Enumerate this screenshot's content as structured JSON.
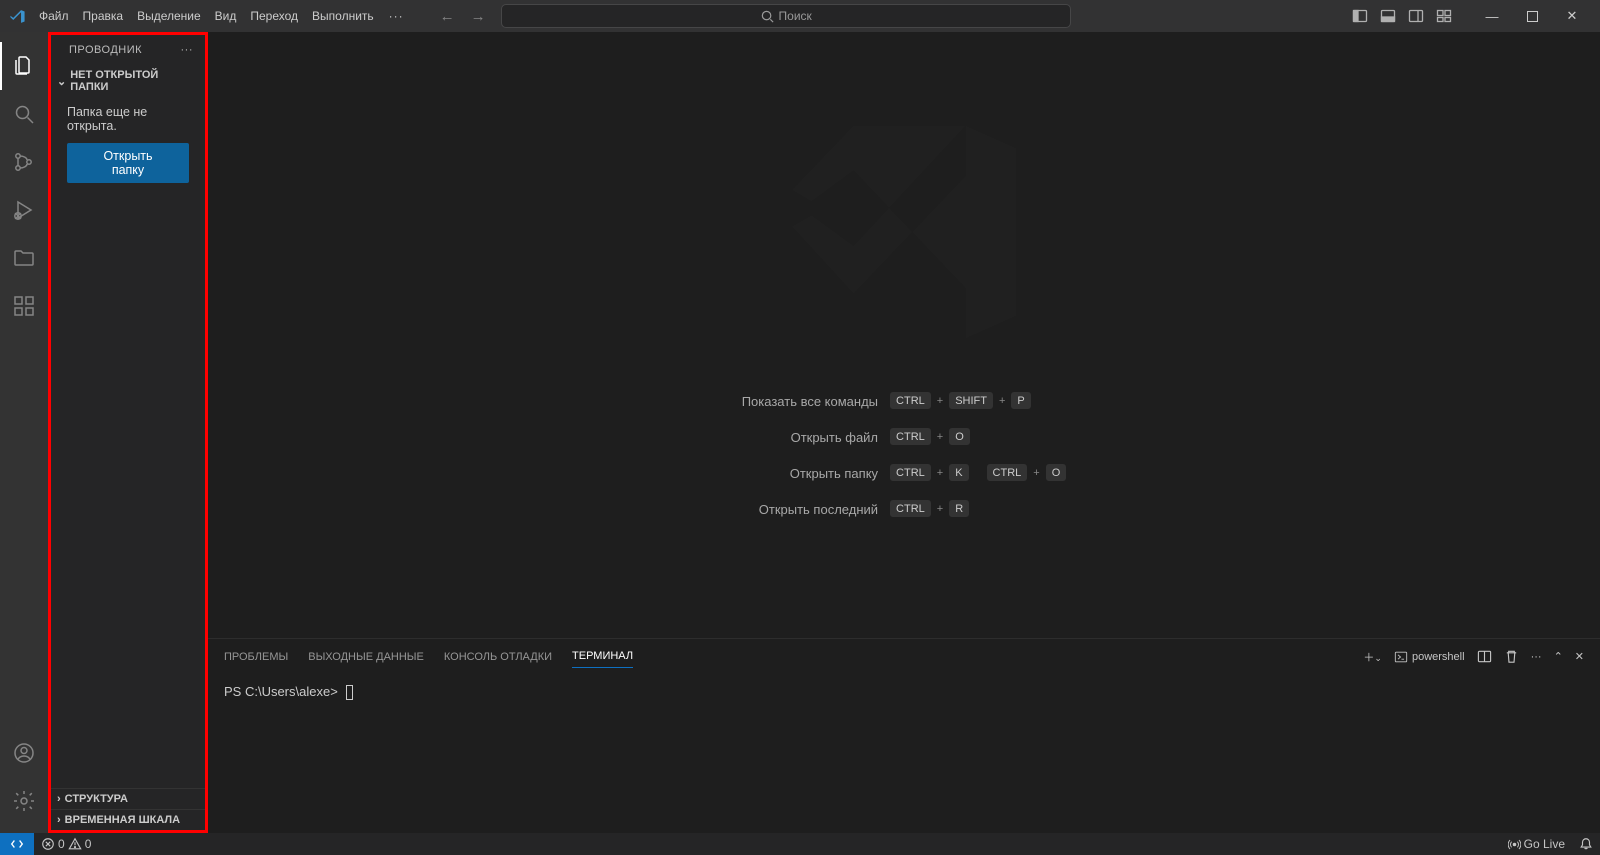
{
  "menu": [
    "Файл",
    "Правка",
    "Выделение",
    "Вид",
    "Переход",
    "Выполнить"
  ],
  "search_placeholder": "Поиск",
  "sidebar": {
    "title": "ПРОВОДНИК",
    "section_title": "НЕТ ОТКРЫТОЙ ПАПКИ",
    "no_folder_text": "Папка еще не открыта.",
    "open_folder_btn": "Открыть папку",
    "struktura": "СТРУКТУРА",
    "timeline": "ВРЕМЕННАЯ ШКАЛА"
  },
  "welcome": {
    "shortcuts": [
      {
        "label": "Показать все команды",
        "keys": [
          "CTRL",
          "+",
          "SHIFT",
          "+",
          "P"
        ]
      },
      {
        "label": "Открыть файл",
        "keys": [
          "CTRL",
          "+",
          "O"
        ]
      },
      {
        "label": "Открыть папку",
        "keys": [
          "CTRL",
          "+",
          "K",
          "",
          "CTRL",
          "+",
          "O"
        ]
      },
      {
        "label": "Открыть последний",
        "keys": [
          "CTRL",
          "+",
          "R"
        ]
      }
    ]
  },
  "panel": {
    "tabs": [
      "ПРОБЛЕМЫ",
      "ВЫХОДНЫЕ ДАННЫЕ",
      "КОНСОЛЬ ОТЛАДКИ",
      "ТЕРМИНАЛ"
    ],
    "active_tab_index": 3,
    "shell_label": "powershell",
    "prompt": "PS C:\\Users\\alexe>"
  },
  "statusbar": {
    "errors": "0",
    "warnings": "0",
    "golive": "Go Live"
  }
}
